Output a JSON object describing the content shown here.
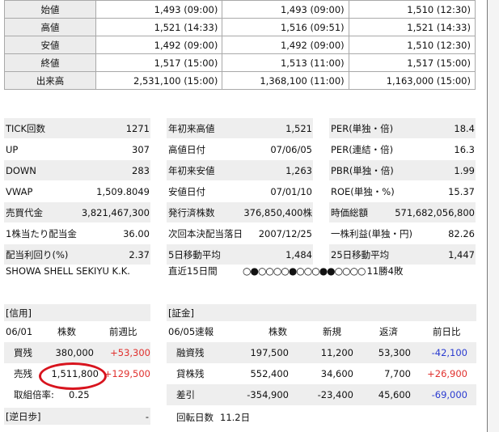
{
  "price_table": {
    "rows": [
      {
        "label": "始値",
        "c1": "1,493 (09:00)",
        "c2": "1,493 (09:00)",
        "c3": "1,510 (12:30)"
      },
      {
        "label": "高値",
        "c1": "1,521 (14:33)",
        "c2": "1,516 (09:51)",
        "c3": "1,521 (14:33)"
      },
      {
        "label": "安値",
        "c1": "1,492 (09:00)",
        "c2": "1,492 (09:00)",
        "c3": "1,510 (12:30)"
      },
      {
        "label": "終値",
        "c1": "1,517 (15:00)",
        "c2": "1,513 (11:00)",
        "c3": "1,517 (15:00)"
      },
      {
        "label": "出来高",
        "c1": "2,531,100 (15:00)",
        "c2": "1,368,100 (11:00)",
        "c3": "1,163,000 (15:00)"
      }
    ]
  },
  "stats_left": [
    {
      "label": "TICK回数",
      "value": "1271"
    },
    {
      "label": "UP",
      "value": "307"
    },
    {
      "label": "DOWN",
      "value": "283"
    },
    {
      "label": "VWAP",
      "value": "1,509.8049"
    },
    {
      "label": "売買代金",
      "value": "3,821,467,300"
    },
    {
      "label": "1株当たり配当金",
      "value": "36.00"
    },
    {
      "label": "配当利回り(%)",
      "value": "2.37"
    }
  ],
  "stats_mid": [
    {
      "label": "年初来高値",
      "value": "1,521"
    },
    {
      "label": "高値日付",
      "value": "07/06/05"
    },
    {
      "label": "年初来安値",
      "value": "1,263"
    },
    {
      "label": "安値日付",
      "value": "07/01/10"
    },
    {
      "label": "発行済株数",
      "value": "376,850,400株"
    },
    {
      "label": "次回本決配当落日",
      "value": "2007/12/25"
    },
    {
      "label": "5日移動平均",
      "value": "1,484"
    }
  ],
  "stats_right": [
    {
      "label": "PER(単独・倍)",
      "value": "18.4"
    },
    {
      "label": "PER(連結・倍)",
      "value": "16.3"
    },
    {
      "label": "PBR(単独・倍)",
      "value": "1.99"
    },
    {
      "label": "ROE(単独・%)",
      "value": "15.37"
    },
    {
      "label": "時価総額",
      "value": "571,682,056,800"
    },
    {
      "label": "一株利益(単独・円)",
      "value": "82.26"
    },
    {
      "label": "25日移動平均",
      "value": "1,447"
    }
  ],
  "company_name": "SHOWA SHELL SEKIYU K.K.",
  "recent15": {
    "label": "直近15日間",
    "marks": "○●○○○○●○○○●●○○○○",
    "result": "11勝4敗"
  },
  "credit": {
    "title": "[信用]",
    "header": {
      "date": "06/01",
      "shares": "株数",
      "change": "前週比"
    },
    "buy": {
      "label": "買残",
      "shares": "380,000",
      "change": "+53,300"
    },
    "sell": {
      "label": "売残",
      "shares": "1,511,800",
      "change": "+129,500"
    },
    "ratio": {
      "label": "取組倍率:",
      "value": "0.25"
    }
  },
  "reverse": {
    "label": "[逆日歩]",
    "value": "-"
  },
  "securities": {
    "title": "[証金]",
    "header": {
      "date": "06/05速報",
      "shares": "株数",
      "new": "新規",
      "repay": "返済",
      "prev": "前日比"
    },
    "rows": [
      {
        "label": "融資残",
        "shares": "197,500",
        "new": "11,200",
        "repay": "53,300",
        "prev": "-42,100",
        "prev_color": "blue"
      },
      {
        "label": "貸株残",
        "shares": "552,400",
        "new": "34,600",
        "repay": "7,700",
        "prev": "+26,900",
        "prev_color": "red"
      },
      {
        "label": "差引",
        "shares": "-354,900",
        "new": "-23,400",
        "repay": "45,600",
        "prev": "-69,000",
        "prev_color": "blue"
      }
    ],
    "turnover": {
      "label": "回転日数",
      "value": "11.2日"
    }
  },
  "colors": {
    "positive": "#e0302d",
    "negative": "#2a3bd0",
    "highlight_circle": "#d8141e",
    "row_shade": "#eeeeee"
  }
}
